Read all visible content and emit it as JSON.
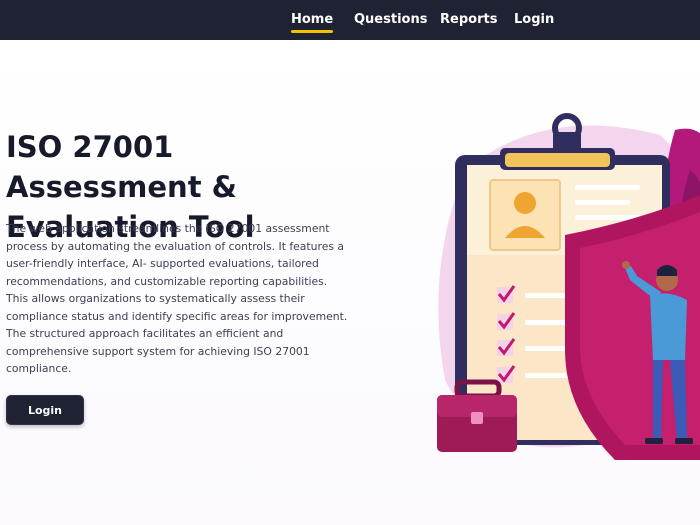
{
  "nav": {
    "items": [
      {
        "label": "Home",
        "active": true
      },
      {
        "label": "Questions",
        "active": false
      },
      {
        "label": "Reports",
        "active": false
      },
      {
        "label": "Login",
        "active": false
      }
    ]
  },
  "hero": {
    "title": "ISO 27001 Assessment & Evaluation Tool",
    "description": "The web application streamlines the ISO 27001 assessment process by automating the evaluation of controls. It features a user-friendly interface, AI- supported evaluations, tailored recommendations, and customizable reporting capabilities. This allows organizations to systematically assess their compliance status and identify specific areas for improvement. The structured approach facilitates an efficient and comprehensive support system for achieving ISO 27001 compliance.",
    "cta_label": "Login"
  },
  "illustration": {
    "name": "clipboard-shield-illustration",
    "colors": {
      "shield": "#b0155f",
      "clipboard_frame": "#2f2e5e",
      "paper": "#fbe6c8",
      "clip": "#f2c35a",
      "checks": "#c01a6e",
      "briefcase": "#9e1b58",
      "shirt": "#4b9ad8",
      "backdrop": "#f3d6ee"
    }
  }
}
